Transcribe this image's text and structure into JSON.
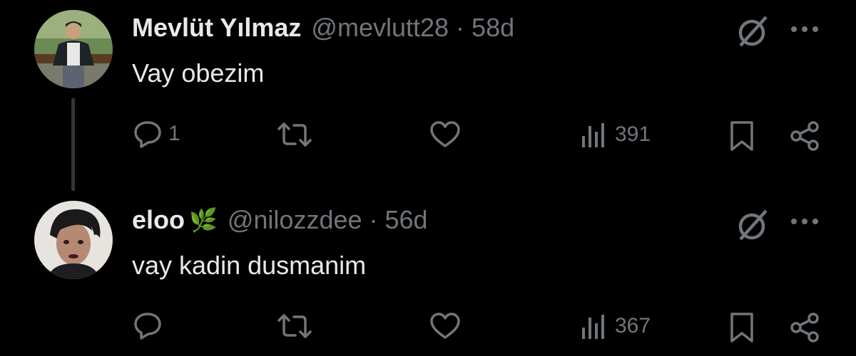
{
  "tweets": [
    {
      "name": "Mevlüt Yılmaz",
      "handle": "@mevlutt28",
      "separator": "·",
      "time": "58d",
      "text": "Vay obezim",
      "reply_count": "1",
      "views": "391",
      "avatar_icon": "user-photo-man-bench"
    },
    {
      "name": "eloo",
      "emoji": "🌿",
      "handle": "@nilozzdee",
      "separator": "·",
      "time": "56d",
      "text": "vay kadin dusmanim",
      "reply_count": "",
      "views": "367",
      "avatar_icon": "user-photo-woman"
    }
  ],
  "colors": {
    "background": "#000000",
    "text": "#e7e9ea",
    "muted": "#71767b",
    "thread_line": "#333639"
  },
  "icons": [
    "reply-icon",
    "retweet-icon",
    "like-icon",
    "views-icon",
    "bookmark-icon",
    "share-icon",
    "grok-icon",
    "more-icon"
  ]
}
